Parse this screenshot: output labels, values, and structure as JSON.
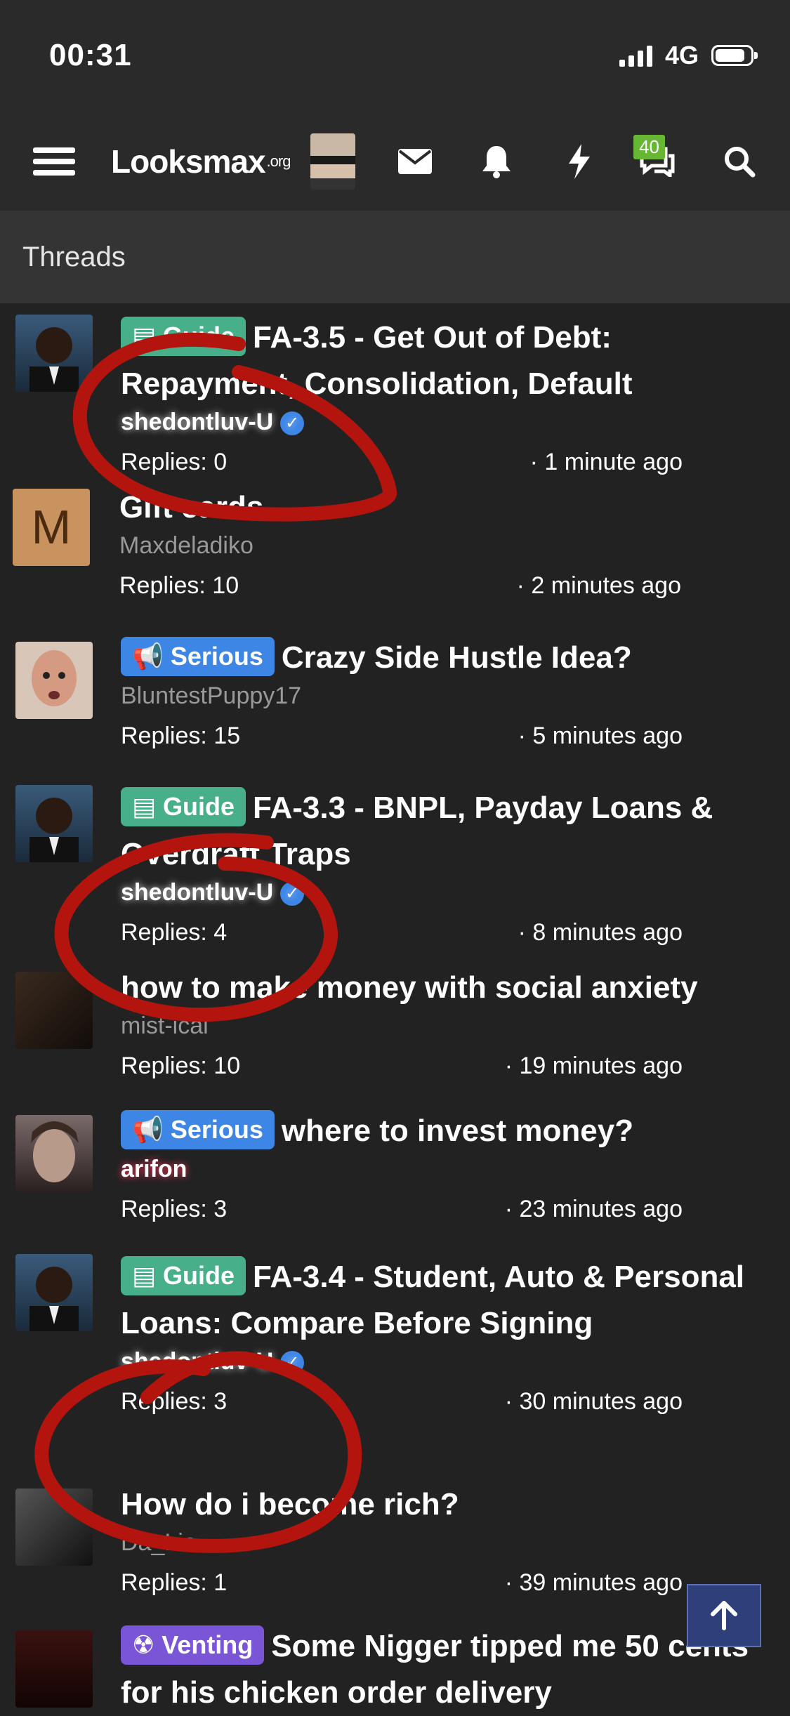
{
  "status_bar": {
    "time": "00:31",
    "network": "4G"
  },
  "navbar": {
    "logo_main": "Looksmax",
    "logo_suffix": ".org",
    "conversations_badge": "40",
    "icons": [
      "menu-icon",
      "avatar",
      "mail-icon",
      "bell-icon",
      "bolt-icon",
      "chat-icon",
      "search-icon"
    ]
  },
  "section": {
    "title": "Threads"
  },
  "threads": [
    {
      "prefix": "Guide",
      "prefix_type": "guide",
      "title": "FA-3.5 - Get Out of Debt: Repayment, Consolidation, Default",
      "author": "shedontluv-U",
      "verified": true,
      "replies": "Replies: 0",
      "date": "· 1 minute ago"
    },
    {
      "prefix": "",
      "prefix_type": "",
      "title": "Gift cards",
      "author": "Maxdeladiko",
      "verified": false,
      "replies": "Replies: 10",
      "date": "· 2 minutes ago"
    },
    {
      "prefix": "Serious",
      "prefix_type": "serious",
      "title": "Crazy Side Hustle Idea?",
      "author": "BluntestPuppy17",
      "verified": false,
      "replies": "Replies: 15",
      "date": "· 5 minutes ago"
    },
    {
      "prefix": "Guide",
      "prefix_type": "guide",
      "title": "FA-3.3 - BNPL, Payday Loans & Overdraft Traps",
      "author": "shedontluv-U",
      "verified": true,
      "replies": "Replies: 4",
      "date": "· 8 minutes ago"
    },
    {
      "prefix": "",
      "prefix_type": "",
      "title": "how to make money with social anxiety",
      "author": "mist-ical",
      "verified": false,
      "replies": "Replies: 10",
      "date": "· 19 minutes ago"
    },
    {
      "prefix": "Serious",
      "prefix_type": "serious",
      "title": "where to invest money?",
      "author": "arifon",
      "verified": false,
      "replies": "Replies: 3",
      "date": "· 23 minutes ago"
    },
    {
      "prefix": "Guide",
      "prefix_type": "guide",
      "title": "FA-3.4 - Student, Auto & Personal Loans: Compare Before Signing",
      "author": "shedontluv-U",
      "verified": true,
      "replies": "Replies: 3",
      "date": "· 30 minutes ago"
    },
    {
      "prefix": "",
      "prefix_type": "",
      "title": "How do i become rich?",
      "author": "Da_Lio",
      "verified": false,
      "replies": "Replies: 1",
      "date": "· 39 minutes ago"
    },
    {
      "prefix": "Venting",
      "prefix_type": "venting",
      "title": "Some Nigger tipped me 50 cents for his chicken order delivery",
      "author": "",
      "verified": false,
      "replies": "",
      "date": ""
    }
  ],
  "colors": {
    "guide": "#47b08a",
    "serious": "#3d86e6",
    "venting": "#7a55d6",
    "badge": "#67b735",
    "annotation": "#b3140e"
  }
}
